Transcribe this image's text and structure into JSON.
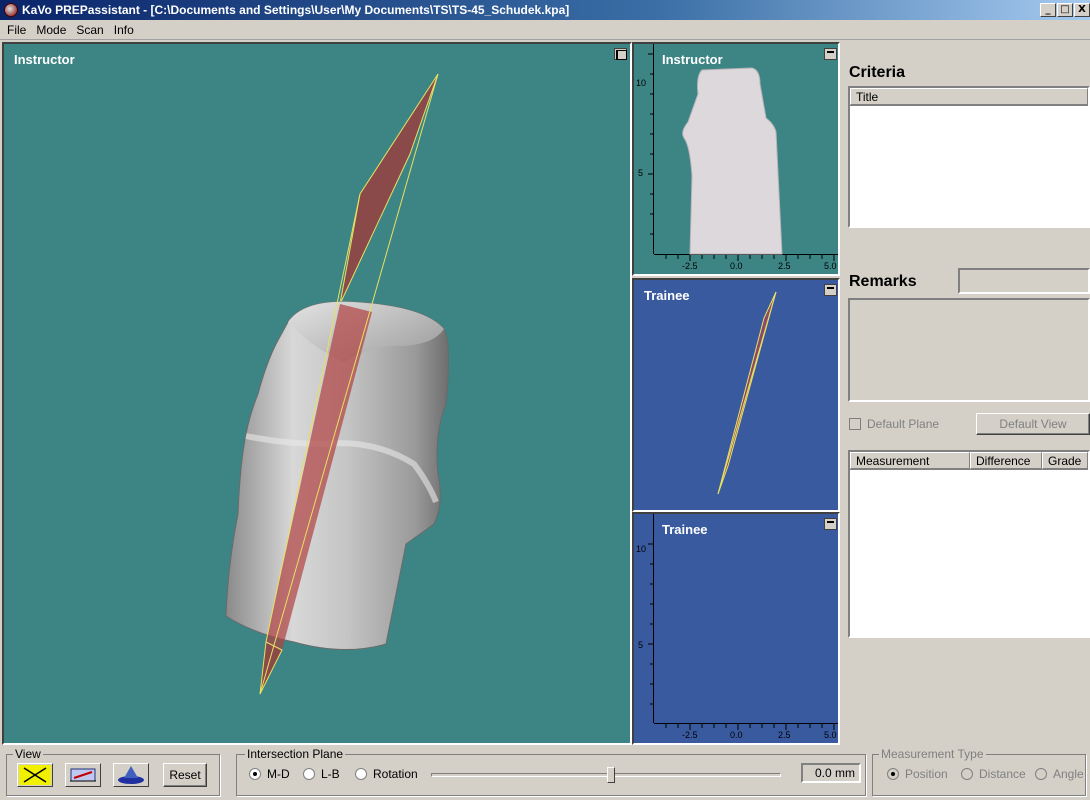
{
  "window": {
    "title": "KaVo PREPassistant - [C:\\Documents and Settings\\User\\My Documents\\TS\\TS-45_Schudek.kpa]",
    "buttons": [
      "_",
      "□",
      "X"
    ]
  },
  "menu": [
    "File",
    "Mode",
    "Scan",
    "Info"
  ],
  "main_view": {
    "label": "Instructor"
  },
  "panels": {
    "top": {
      "label": "Instructor",
      "y_ticks": [
        "10",
        "5"
      ],
      "x_ticks": [
        "-2.5",
        "0.0",
        "2.5",
        "5.0"
      ]
    },
    "middle": {
      "label": "Trainee"
    },
    "bottom": {
      "label": "Trainee",
      "y_ticks": [
        "10",
        "5"
      ],
      "x_ticks": [
        "-2.5",
        "0.0",
        "2.5",
        "5.0"
      ]
    }
  },
  "criteria": {
    "title": "Criteria",
    "columns": [
      "Title"
    ]
  },
  "remarks": {
    "title": "Remarks"
  },
  "default_plane": {
    "label": "Default Plane",
    "checked": false
  },
  "default_view": {
    "label": "Default View"
  },
  "measurement_table": {
    "columns": [
      "Measurement",
      "Difference",
      "Grade"
    ]
  },
  "view_group": {
    "title": "View",
    "reset_label": "Reset",
    "icons": [
      "rotate-arrows-icon",
      "move-plane-icon",
      "view-from-top-icon"
    ]
  },
  "intersection_plane": {
    "title": "Intersection Plane",
    "options": [
      "M-D",
      "L-B",
      "Rotation"
    ],
    "selected": "M-D",
    "slider_position": 0.58,
    "value": "0.0 mm"
  },
  "measurement_type": {
    "title": "Measurement Type",
    "options": [
      "Position",
      "Distance",
      "Angle"
    ],
    "selected": "Position"
  },
  "colors": {
    "teal_view": "#3d8585",
    "blue_view": "#3a5aa0",
    "plane_red": "#a04848",
    "plane_edge": "#e8e060"
  }
}
